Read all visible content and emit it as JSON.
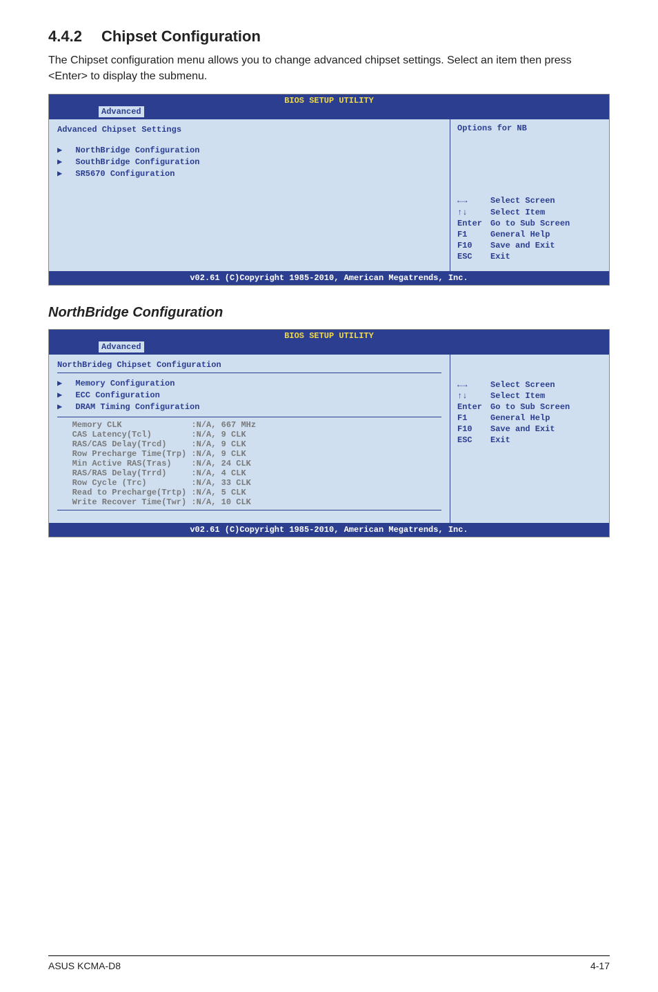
{
  "section": {
    "number": "4.4.2",
    "title": "Chipset Configuration",
    "description": "The Chipset configuration menu allows you to change advanced chipset settings. Select an item then press <Enter> to display the submenu."
  },
  "bios1": {
    "utility_title": "BIOS SETUP UTILITY",
    "tab": "Advanced",
    "left_heading": "Advanced Chipset Settings",
    "items": [
      "NorthBridge Configuration",
      "SouthBridge Configuration",
      "SR5670 Configuration"
    ],
    "right_heading": "Options for NB",
    "help": {
      "l1_key": "←→",
      "l1_text": "Select Screen",
      "l2_key": "↑↓",
      "l2_text": "Select Item",
      "l3_key": "Enter",
      "l3_text": "Go to Sub Screen",
      "l4_key": "F1",
      "l4_text": "General Help",
      "l5_key": "F10",
      "l5_text": "Save and Exit",
      "l6_key": "ESC",
      "l6_text": "Exit"
    },
    "footer": "v02.61 (C)Copyright 1985-2010, American Megatrends, Inc."
  },
  "subheading": "NorthBridge Configuration",
  "bios2": {
    "utility_title": "BIOS SETUP UTILITY",
    "tab": "Advanced",
    "left_heading": "NorthBrideg Chipset Configuration",
    "config_items": [
      "Memory Configuration",
      "ECC Configuration",
      "DRAM Timing Configuration"
    ],
    "info_rows": [
      {
        "label": "Memory CLK",
        "value": ":N/A, 667 MHz"
      },
      {
        "label": "CAS Latency(Tcl)",
        "value": ":N/A, 9 CLK"
      },
      {
        "label": "RAS/CAS Delay(Trcd)",
        "value": ":N/A, 9 CLK"
      },
      {
        "label": "Row Precharge Time(Trp)",
        "value": ":N/A, 9 CLK"
      },
      {
        "label": "Min Active RAS(Tras)",
        "value": ":N/A, 24 CLK"
      },
      {
        "label": "RAS/RAS Delay(Trrd)",
        "value": ":N/A, 4 CLK"
      },
      {
        "label": "Row Cycle (Trc)",
        "value": ":N/A, 33 CLK"
      },
      {
        "label": "Read to Precharge(Trtp)",
        "value": ":N/A, 5 CLK"
      },
      {
        "label": "Write Recover Time(Twr)",
        "value": ":N/A, 10 CLK"
      }
    ],
    "help": {
      "l1_key": "←→",
      "l1_text": "Select Screen",
      "l2_key": "↑↓",
      "l2_text": "Select Item",
      "l3_key": "Enter",
      "l3_text": "Go to Sub Screen",
      "l4_key": "F1",
      "l4_text": "General Help",
      "l5_key": "F10",
      "l5_text": "Save and Exit",
      "l6_key": "ESC",
      "l6_text": "Exit"
    },
    "footer": "v02.61 (C)Copyright 1985-2010, American Megatrends, Inc."
  },
  "page_footer": {
    "left": "ASUS KCMA-D8",
    "right": "4-17"
  }
}
